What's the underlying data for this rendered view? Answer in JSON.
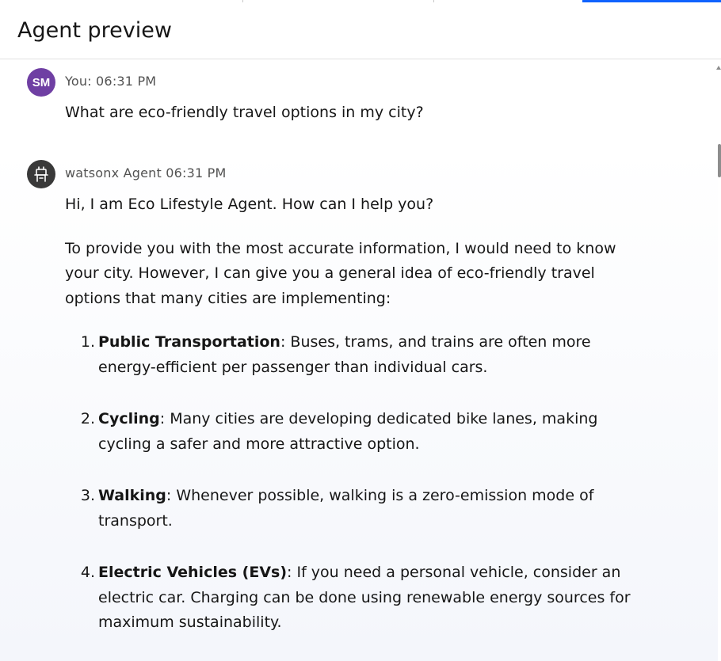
{
  "header": {
    "title": "Agent preview"
  },
  "user_message": {
    "avatar_initials": "SM",
    "meta": "You: 06:31 PM",
    "text": "What are eco-friendly travel options in my city?"
  },
  "agent_message": {
    "avatar_icon": "robot-icon",
    "meta": "watsonx Agent 06:31 PM",
    "greeting": "Hi, I am Eco Lifestyle Agent. How can I help you?",
    "intro": "To provide you with the most accurate information, I would need to know your city. However, I can give you a general idea of eco-friendly travel options that many cities are implementing:",
    "items": [
      {
        "number": "1.",
        "title": "Public Transportation",
        "body": ": Buses, trams, and trains are often more energy-efficient per passenger than individual cars."
      },
      {
        "number": "2.",
        "title": "Cycling",
        "body": ": Many cities are developing dedicated bike lanes, making cycling a safer and more attractive option."
      },
      {
        "number": "3.",
        "title": "Walking",
        "body": ": Whenever possible, walking is a zero-emission mode of transport."
      },
      {
        "number": "4.",
        "title": "Electric Vehicles (EVs)",
        "body": ": If you need a personal vehicle, consider an electric car. Charging can be done using renewable energy sources for maximum sustainability."
      }
    ]
  },
  "colors": {
    "user_avatar": "#6f3fa3",
    "agent_avatar": "#393939",
    "active_tab": "#0f62fe"
  }
}
